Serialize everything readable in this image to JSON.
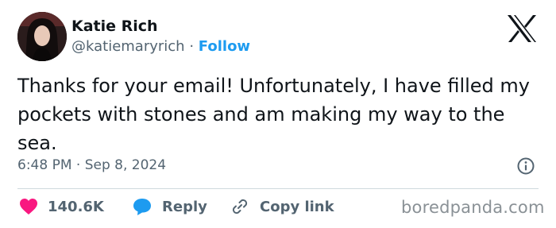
{
  "author": {
    "name": "Katie Rich",
    "handle": "@katiemaryrich",
    "separator": "·",
    "follow_label": "Follow"
  },
  "tweet": {
    "text": "Thanks for your email! Unfortunately, I have filled my pockets with stones and am making my way to the sea.",
    "timestamp": "6:48 PM · Sep 8, 2024"
  },
  "actions": {
    "like_count": "140.6K",
    "reply_label": "Reply",
    "copy_link_label": "Copy link"
  },
  "watermark": "boredpanda.com",
  "icons": {
    "like": "heart-icon",
    "reply": "speech-bubble-icon",
    "copy": "link-icon",
    "info": "info-icon",
    "platform": "x-logo-icon"
  },
  "colors": {
    "text": "#0f1419",
    "muted": "#536471",
    "accent": "#1d9bf0",
    "like": "#f91880",
    "divider": "#cfd9de"
  }
}
